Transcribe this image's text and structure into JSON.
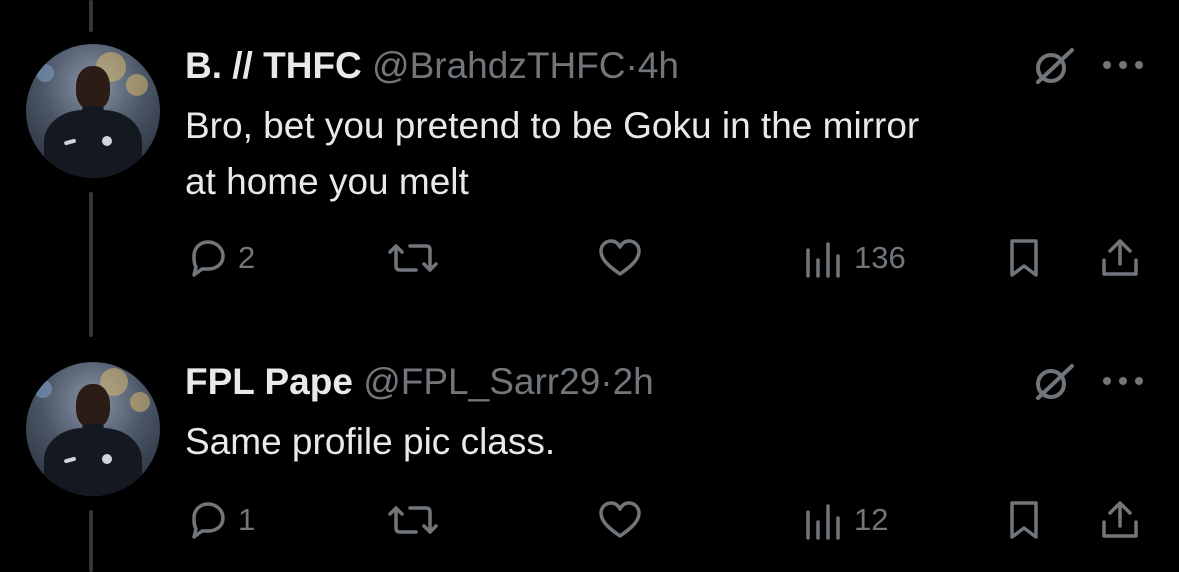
{
  "tweets": [
    {
      "author_name": "B. // THFC",
      "handle": "@BrahdzTHFC",
      "separator": "·",
      "time": "4h",
      "text_lines": [
        "Bro, bet you pretend to be Goku in the mirror",
        "at home you melt"
      ],
      "replies": "2",
      "views": "136"
    },
    {
      "author_name": "FPL Pape",
      "handle": "@FPL_Sarr29",
      "separator": "·",
      "time": "2h",
      "text_lines": [
        "Same profile pic class."
      ],
      "replies": "1",
      "views": "12"
    }
  ],
  "icons": {
    "grok": "grok-icon",
    "more": "more-icon",
    "reply": "reply-icon",
    "retweet": "retweet-icon",
    "like": "like-icon",
    "views": "views-icon",
    "bookmark": "bookmark-icon",
    "share": "share-icon"
  },
  "colors": {
    "background": "#000000",
    "text": "#e7e9ea",
    "secondary": "#71767b",
    "thread_line": "#333639"
  }
}
